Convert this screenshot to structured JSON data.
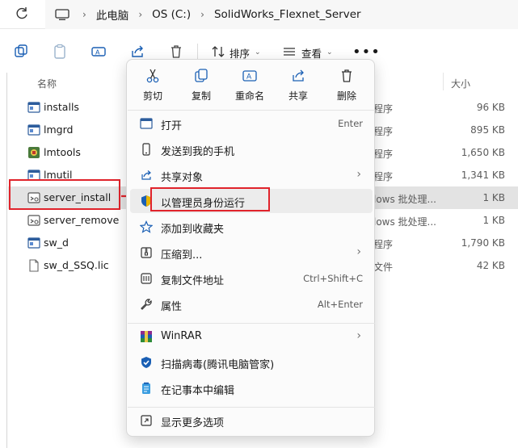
{
  "address": {
    "crumbs": [
      "此电脑",
      "OS (C:)",
      "SolidWorks_Flexnet_Server"
    ]
  },
  "toolbar": {
    "sort_label": "排序",
    "view_label": "查看"
  },
  "list": {
    "col_name": "名称",
    "col_size": "大小",
    "rows": [
      {
        "name": "installs",
        "type": "程序",
        "size": "96 KB",
        "icon": "app-icon"
      },
      {
        "name": "lmgrd",
        "type": "程序",
        "size": "895 KB",
        "icon": "app-icon"
      },
      {
        "name": "lmtools",
        "type": "程序",
        "size": "1,650 KB",
        "icon": "lmtools-icon"
      },
      {
        "name": "lmutil",
        "type": "程序",
        "size": "1,341 KB",
        "icon": "app-icon"
      },
      {
        "name": "server_install",
        "type": "lows 批处理...",
        "size": "1 KB",
        "icon": "batch-icon"
      },
      {
        "name": "server_remove",
        "type": "lows 批处理...",
        "size": "1 KB",
        "icon": "batch-icon"
      },
      {
        "name": "sw_d",
        "type": "程序",
        "size": "1,790 KB",
        "icon": "app-icon"
      },
      {
        "name": "sw_d_SSQ.lic",
        "type": "文件",
        "size": "42 KB",
        "icon": "file-icon"
      }
    ]
  },
  "context_menu": {
    "quick_actions": [
      "剪切",
      "复制",
      "重命名",
      "共享",
      "删除"
    ],
    "items": [
      {
        "label": "打开",
        "shortcut": "Enter",
        "icon": "open-icon"
      },
      {
        "label": "发送到我的手机",
        "shortcut": "",
        "icon": "phone-icon"
      },
      {
        "label": "共享对象",
        "shortcut": "",
        "icon": "share-icon"
      },
      {
        "label": "以管理员身份运行",
        "shortcut": "",
        "icon": "shield-icon"
      },
      {
        "label": "添加到收藏夹",
        "shortcut": "",
        "icon": "star-icon"
      },
      {
        "label": "压缩到...",
        "shortcut": "",
        "icon": "zip-icon"
      },
      {
        "label": "复制文件地址",
        "shortcut": "Ctrl+Shift+C",
        "icon": "copy-path-icon"
      },
      {
        "label": "属性",
        "shortcut": "Alt+Enter",
        "icon": "wrench-icon"
      },
      {
        "label": "WinRAR",
        "shortcut": "",
        "icon": "winrar-icon"
      },
      {
        "label": "扫描病毒(腾讯电脑管家)",
        "shortcut": "",
        "icon": "antivirus-icon"
      },
      {
        "label": "在记事本中编辑",
        "shortcut": "",
        "icon": "notepad-icon"
      },
      {
        "label": "显示更多选项",
        "shortcut": "",
        "icon": "more-options-icon"
      }
    ]
  },
  "colors": {
    "annotation_red": "#e0232b",
    "selection": "#e3e3e3"
  }
}
